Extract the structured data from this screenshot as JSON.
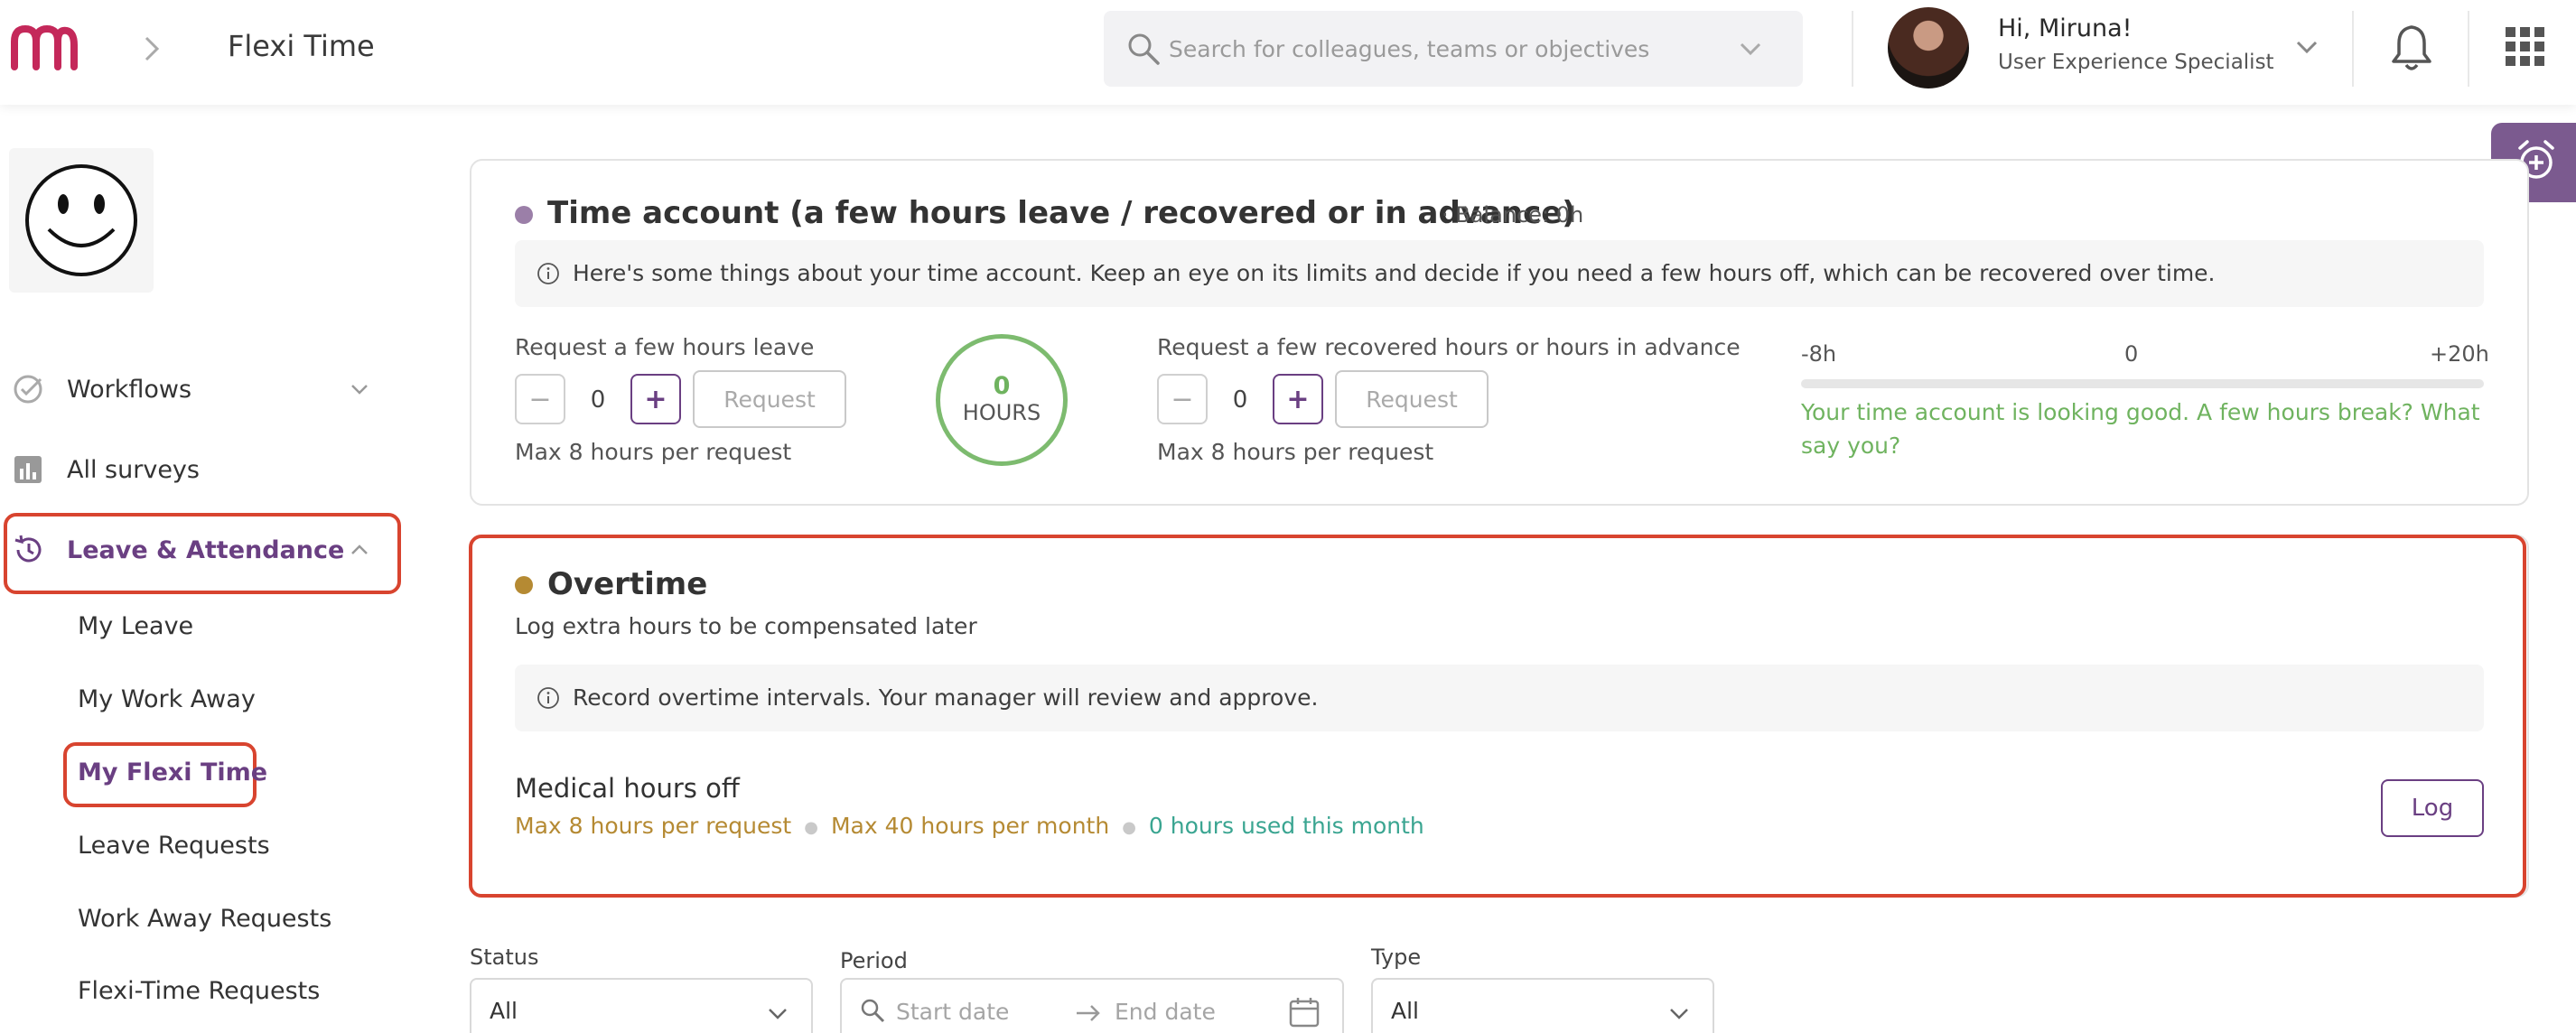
{
  "header": {
    "app_title": "Flexi Time",
    "search_placeholder": "Search for colleagues, teams or objectives",
    "greeting": "Hi, Miruna!",
    "role": "User Experience Specialist"
  },
  "sidebar": {
    "items": [
      {
        "label": "Workflows"
      },
      {
        "label": "All surveys"
      },
      {
        "label": "Leave & Attendance"
      }
    ],
    "subitems": [
      {
        "label": "My Leave"
      },
      {
        "label": "My Work Away"
      },
      {
        "label": "My Flexi Time"
      },
      {
        "label": "Leave Requests"
      },
      {
        "label": "Work Away Requests"
      },
      {
        "label": "Flexi-Time Requests"
      }
    ]
  },
  "time_account": {
    "title": "Time account (a few hours leave / recovered or in advance)",
    "balance": "· Balance: 0h",
    "info": "Here's some things about your time account. Keep an eye on its limits and decide if you need a few hours off, which can be recovered over time.",
    "leave": {
      "label": "Request a few hours leave",
      "value": "0",
      "minus": "−",
      "plus": "+",
      "button": "Request",
      "max": "Max 8 hours per request"
    },
    "hours_value": "0",
    "hours_unit": "HOURS",
    "recovered": {
      "label": "Request a few recovered hours or hours in advance",
      "value": "0",
      "minus": "−",
      "plus": "+",
      "button": "Request",
      "max": "Max 8 hours per request"
    },
    "range": {
      "min": "-8h",
      "mid": "0",
      "max": "+20h"
    },
    "message": "Your time account is looking good. A few hours break? What say you?"
  },
  "overtime": {
    "title": "Overtime",
    "subtitle": "Log extra hours to be compensated later",
    "info": "Record overtime intervals. Your manager will review and approve.",
    "medical": {
      "title": "Medical hours off",
      "max_request": "Max 8 hours per request",
      "max_month": "Max 40 hours per month",
      "used": "0 hours used this month",
      "log_button": "Log"
    }
  },
  "filters": {
    "status_label": "Status",
    "status_value": "All",
    "period_label": "Period",
    "start_placeholder": "Start date",
    "end_placeholder": "End date",
    "type_label": "Type",
    "type_value": "All"
  },
  "colors": {
    "accent": "#6a3f82",
    "highlight": "#d8442f",
    "time_dot": "#9b7fa8",
    "overtime_dot": "#b58a33",
    "success": "#6fb35f",
    "teal": "#3aa591"
  }
}
